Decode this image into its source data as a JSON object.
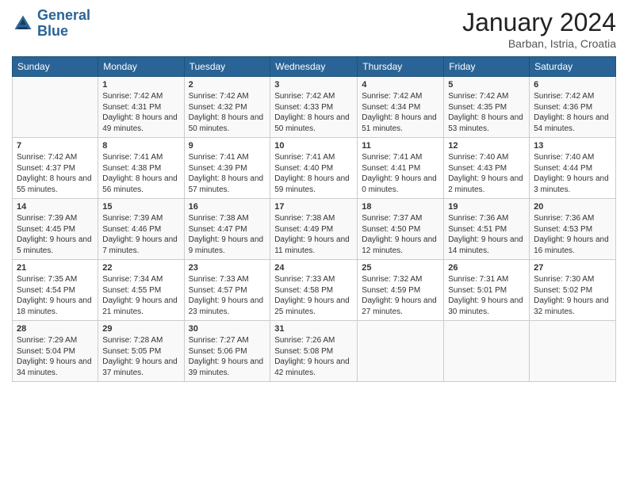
{
  "header": {
    "logo_line1": "General",
    "logo_line2": "Blue",
    "month_title": "January 2024",
    "location": "Barban, Istria, Croatia"
  },
  "days_of_week": [
    "Sunday",
    "Monday",
    "Tuesday",
    "Wednesday",
    "Thursday",
    "Friday",
    "Saturday"
  ],
  "weeks": [
    [
      {
        "day": "",
        "info": ""
      },
      {
        "day": "1",
        "info": "Sunrise: 7:42 AM\nSunset: 4:31 PM\nDaylight: 8 hours\nand 49 minutes."
      },
      {
        "day": "2",
        "info": "Sunrise: 7:42 AM\nSunset: 4:32 PM\nDaylight: 8 hours\nand 50 minutes."
      },
      {
        "day": "3",
        "info": "Sunrise: 7:42 AM\nSunset: 4:33 PM\nDaylight: 8 hours\nand 50 minutes."
      },
      {
        "day": "4",
        "info": "Sunrise: 7:42 AM\nSunset: 4:34 PM\nDaylight: 8 hours\nand 51 minutes."
      },
      {
        "day": "5",
        "info": "Sunrise: 7:42 AM\nSunset: 4:35 PM\nDaylight: 8 hours\nand 53 minutes."
      },
      {
        "day": "6",
        "info": "Sunrise: 7:42 AM\nSunset: 4:36 PM\nDaylight: 8 hours\nand 54 minutes."
      }
    ],
    [
      {
        "day": "7",
        "info": "Sunrise: 7:42 AM\nSunset: 4:37 PM\nDaylight: 8 hours\nand 55 minutes."
      },
      {
        "day": "8",
        "info": "Sunrise: 7:41 AM\nSunset: 4:38 PM\nDaylight: 8 hours\nand 56 minutes."
      },
      {
        "day": "9",
        "info": "Sunrise: 7:41 AM\nSunset: 4:39 PM\nDaylight: 8 hours\nand 57 minutes."
      },
      {
        "day": "10",
        "info": "Sunrise: 7:41 AM\nSunset: 4:40 PM\nDaylight: 8 hours\nand 59 minutes."
      },
      {
        "day": "11",
        "info": "Sunrise: 7:41 AM\nSunset: 4:41 PM\nDaylight: 9 hours\nand 0 minutes."
      },
      {
        "day": "12",
        "info": "Sunrise: 7:40 AM\nSunset: 4:43 PM\nDaylight: 9 hours\nand 2 minutes."
      },
      {
        "day": "13",
        "info": "Sunrise: 7:40 AM\nSunset: 4:44 PM\nDaylight: 9 hours\nand 3 minutes."
      }
    ],
    [
      {
        "day": "14",
        "info": "Sunrise: 7:39 AM\nSunset: 4:45 PM\nDaylight: 9 hours\nand 5 minutes."
      },
      {
        "day": "15",
        "info": "Sunrise: 7:39 AM\nSunset: 4:46 PM\nDaylight: 9 hours\nand 7 minutes."
      },
      {
        "day": "16",
        "info": "Sunrise: 7:38 AM\nSunset: 4:47 PM\nDaylight: 9 hours\nand 9 minutes."
      },
      {
        "day": "17",
        "info": "Sunrise: 7:38 AM\nSunset: 4:49 PM\nDaylight: 9 hours\nand 11 minutes."
      },
      {
        "day": "18",
        "info": "Sunrise: 7:37 AM\nSunset: 4:50 PM\nDaylight: 9 hours\nand 12 minutes."
      },
      {
        "day": "19",
        "info": "Sunrise: 7:36 AM\nSunset: 4:51 PM\nDaylight: 9 hours\nand 14 minutes."
      },
      {
        "day": "20",
        "info": "Sunrise: 7:36 AM\nSunset: 4:53 PM\nDaylight: 9 hours\nand 16 minutes."
      }
    ],
    [
      {
        "day": "21",
        "info": "Sunrise: 7:35 AM\nSunset: 4:54 PM\nDaylight: 9 hours\nand 18 minutes."
      },
      {
        "day": "22",
        "info": "Sunrise: 7:34 AM\nSunset: 4:55 PM\nDaylight: 9 hours\nand 21 minutes."
      },
      {
        "day": "23",
        "info": "Sunrise: 7:33 AM\nSunset: 4:57 PM\nDaylight: 9 hours\nand 23 minutes."
      },
      {
        "day": "24",
        "info": "Sunrise: 7:33 AM\nSunset: 4:58 PM\nDaylight: 9 hours\nand 25 minutes."
      },
      {
        "day": "25",
        "info": "Sunrise: 7:32 AM\nSunset: 4:59 PM\nDaylight: 9 hours\nand 27 minutes."
      },
      {
        "day": "26",
        "info": "Sunrise: 7:31 AM\nSunset: 5:01 PM\nDaylight: 9 hours\nand 30 minutes."
      },
      {
        "day": "27",
        "info": "Sunrise: 7:30 AM\nSunset: 5:02 PM\nDaylight: 9 hours\nand 32 minutes."
      }
    ],
    [
      {
        "day": "28",
        "info": "Sunrise: 7:29 AM\nSunset: 5:04 PM\nDaylight: 9 hours\nand 34 minutes."
      },
      {
        "day": "29",
        "info": "Sunrise: 7:28 AM\nSunset: 5:05 PM\nDaylight: 9 hours\nand 37 minutes."
      },
      {
        "day": "30",
        "info": "Sunrise: 7:27 AM\nSunset: 5:06 PM\nDaylight: 9 hours\nand 39 minutes."
      },
      {
        "day": "31",
        "info": "Sunrise: 7:26 AM\nSunset: 5:08 PM\nDaylight: 9 hours\nand 42 minutes."
      },
      {
        "day": "",
        "info": ""
      },
      {
        "day": "",
        "info": ""
      },
      {
        "day": "",
        "info": ""
      }
    ]
  ]
}
